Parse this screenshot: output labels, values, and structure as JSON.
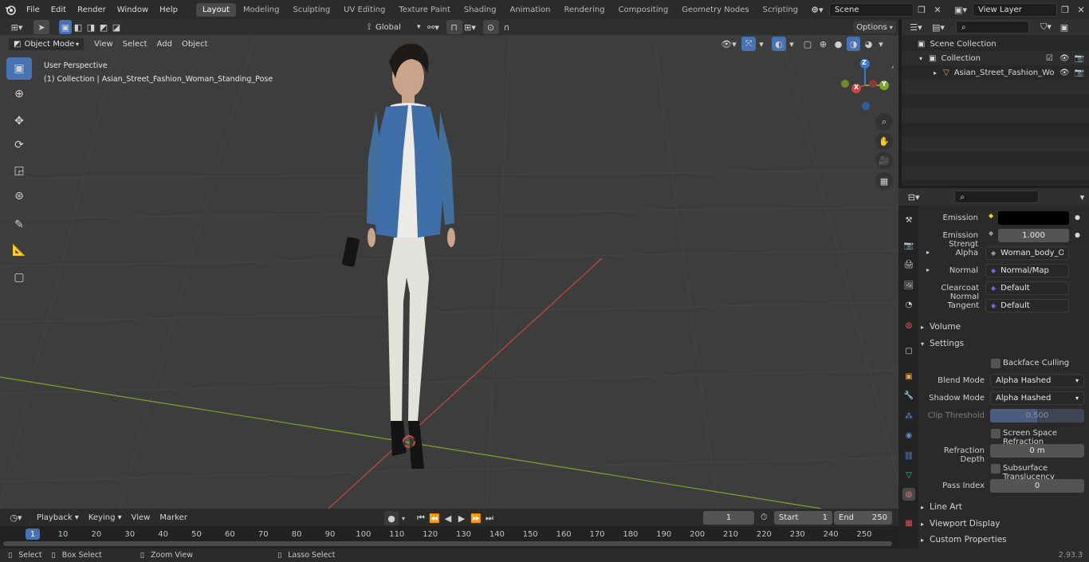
{
  "menubar": {
    "items": [
      "File",
      "Edit",
      "Render",
      "Window",
      "Help"
    ],
    "workspaces": [
      "Layout",
      "Modeling",
      "Sculpting",
      "UV Editing",
      "Texture Paint",
      "Shading",
      "Animation",
      "Rendering",
      "Compositing",
      "Geometry Nodes",
      "Scripting"
    ],
    "active_workspace": "Layout",
    "add_tab": "+",
    "scene": "Scene",
    "view_layer": "View Layer"
  },
  "viewport_header": {
    "mode": "Object Mode",
    "menus": [
      "View",
      "Select",
      "Add",
      "Object"
    ],
    "transform_orientation": "Global",
    "options": "Options"
  },
  "viewport": {
    "perspective_label": "User Perspective",
    "collection_label": "(1) Collection | Asian_Street_Fashion_Woman_Standing_Pose",
    "gizmo_axes": {
      "x": "X",
      "y": "Y",
      "z": "Z"
    }
  },
  "outliner": {
    "scene_collection": "Scene Collection",
    "collection": "Collection",
    "object": "Asian_Street_Fashion_Wo"
  },
  "properties": {
    "fields": [
      {
        "label": "Emission",
        "value": ""
      },
      {
        "label": "Emission Strengt",
        "value": "1.000"
      },
      {
        "label": "Alpha",
        "value": "Woman_body_Opac..."
      },
      {
        "label": "Normal",
        "value": "Normal/Map"
      },
      {
        "label": "Clearcoat Normal",
        "value": "Default"
      },
      {
        "label": "Tangent",
        "value": "Default"
      }
    ],
    "sections": {
      "volume": "Volume",
      "settings": "Settings",
      "line_art": "Line Art",
      "viewport_display": "Viewport Display",
      "custom_properties": "Custom Properties"
    },
    "settings": {
      "backface_culling": "Backface Culling",
      "blend_mode_label": "Blend Mode",
      "blend_mode": "Alpha Hashed",
      "shadow_mode_label": "Shadow Mode",
      "shadow_mode": "Alpha Hashed",
      "clip_threshold_label": "Clip Threshold",
      "clip_threshold": "0.500",
      "ssr": "Screen Space Refraction",
      "refraction_depth_label": "Refraction Depth",
      "refraction_depth": "0 m",
      "subsurface": "Subsurface Translucency",
      "pass_index_label": "Pass Index",
      "pass_index": "0"
    }
  },
  "timeline": {
    "menus": [
      "Playback",
      "Keying",
      "View",
      "Marker"
    ],
    "current_frame": "1",
    "start_label": "Start",
    "start": "1",
    "end_label": "End",
    "end": "250",
    "ruler": [
      "1",
      "10",
      "20",
      "30",
      "40",
      "50",
      "60",
      "70",
      "80",
      "90",
      "100",
      "110",
      "120",
      "130",
      "140",
      "150",
      "160",
      "170",
      "180",
      "190",
      "200",
      "210",
      "220",
      "230",
      "240",
      "250"
    ]
  },
  "statusbar": {
    "select": "Select",
    "box_select": "Box Select",
    "zoom_view": "Zoom View",
    "lasso_select": "Lasso Select",
    "version": "2.93.3"
  },
  "colors": {
    "accent": "#4772b3",
    "viewport_bg": "#3d3d3d",
    "axis_x": "#c84646",
    "axis_y": "#7fa42b",
    "axis_z": "#3b79d1"
  }
}
